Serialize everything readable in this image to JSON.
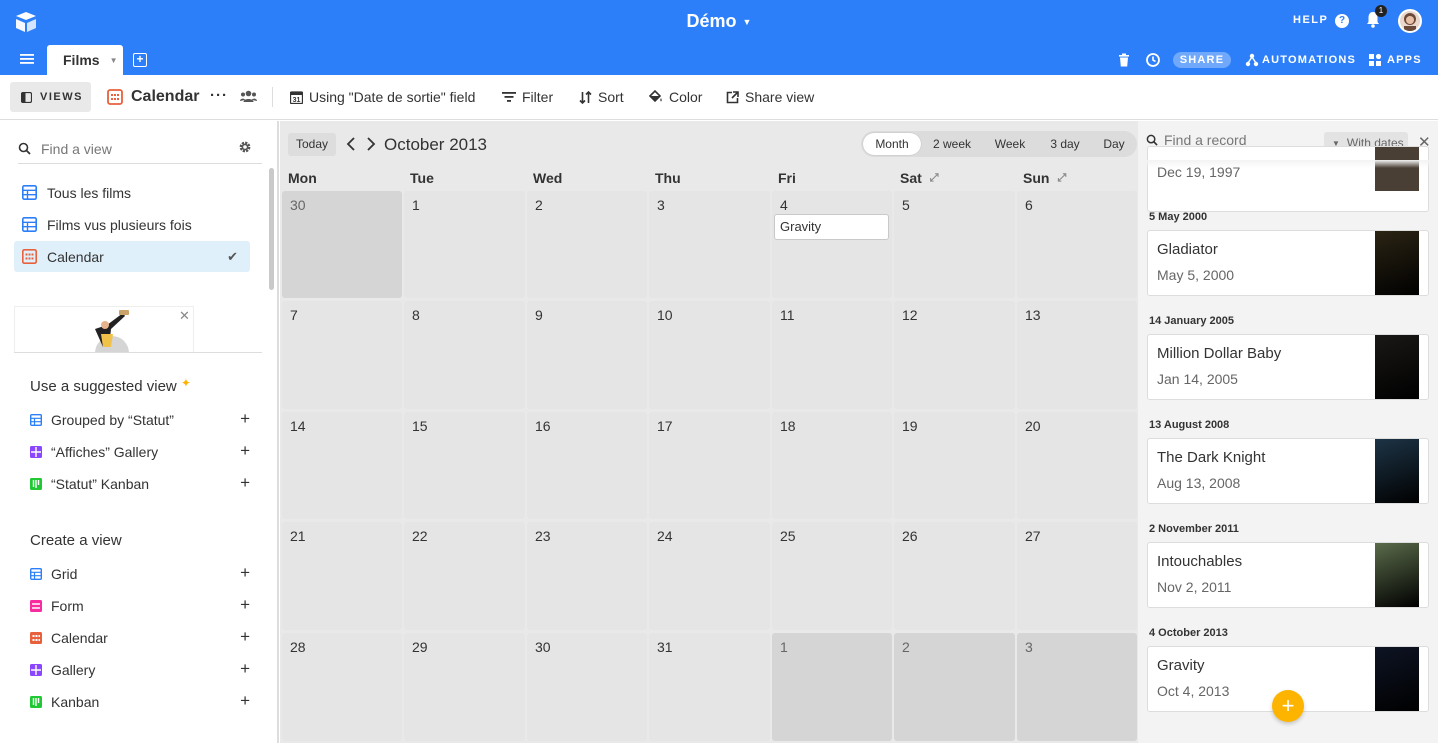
{
  "app": {
    "base_title": "Démo",
    "help_label": "HELP",
    "notification_count": "1",
    "share_label": "SHARE",
    "automations_label": "AUTOMATIONS",
    "apps_label": "APPS",
    "brand_color": "#2d7ff9"
  },
  "table_tab": {
    "label": "Films"
  },
  "toolbar": {
    "views_label": "VIEWS",
    "view_name": "Calendar",
    "more_label": "···",
    "date_field_label": "Using \"Date de sortie\" field",
    "filter_label": "Filter",
    "sort_label": "Sort",
    "color_label": "Color",
    "share_view_label": "Share view"
  },
  "sidebar": {
    "search_placeholder": "Find a view",
    "views": [
      {
        "label": "Tous les films",
        "icon": "grid-view-icon"
      },
      {
        "label": "Films vus plusieurs fois",
        "icon": "grid-view-icon"
      },
      {
        "label": "Calendar",
        "icon": "calendar-view-icon",
        "active": true
      }
    ],
    "suggested_heading": "Use a suggested view",
    "suggested": [
      {
        "label": "Grouped by “Statut”",
        "icon": "grid-view-icon"
      },
      {
        "label": "“Affiches” Gallery",
        "icon": "gallery-view-icon"
      },
      {
        "label": "“Statut” Kanban",
        "icon": "kanban-view-icon"
      }
    ],
    "create_heading": "Create a view",
    "create": [
      {
        "label": "Grid",
        "icon": "grid-view-icon"
      },
      {
        "label": "Form",
        "icon": "form-view-icon"
      },
      {
        "label": "Calendar",
        "icon": "calendar-view-icon"
      },
      {
        "label": "Gallery",
        "icon": "gallery-view-icon"
      },
      {
        "label": "Kanban",
        "icon": "kanban-view-icon"
      }
    ]
  },
  "calendar": {
    "today_label": "Today",
    "month_label": "October 2013",
    "ranges": [
      "Month",
      "2 week",
      "Week",
      "3 day",
      "Day"
    ],
    "active_range": "Month",
    "weekdays": [
      "Mon",
      "Tue",
      "Wed",
      "Thu",
      "Fri",
      "Sat",
      "Sun"
    ],
    "weeks": [
      [
        "30",
        "1",
        "2",
        "3",
        "4",
        "5",
        "6"
      ],
      [
        "7",
        "8",
        "9",
        "10",
        "11",
        "12",
        "13"
      ],
      [
        "14",
        "15",
        "16",
        "17",
        "18",
        "19",
        "20"
      ],
      [
        "21",
        "22",
        "23",
        "24",
        "25",
        "26",
        "27"
      ],
      [
        "28",
        "29",
        "30",
        "31",
        "1",
        "2",
        "3"
      ]
    ],
    "event": {
      "title": "Gravity"
    }
  },
  "records": {
    "search_placeholder": "Find a record",
    "filter_label": "With dates",
    "partial_sub": "Dec 19, 1997",
    "items": [
      {
        "group": "5 May 2000",
        "title": "Gladiator",
        "date": "May 5, 2000",
        "poster": "#2b2414"
      },
      {
        "group": "14 January 2005",
        "title": "Million Dollar Baby",
        "date": "Jan 14, 2005",
        "poster": "#1a1816"
      },
      {
        "group": "13 August 2008",
        "title": "The Dark Knight",
        "date": "Aug 13, 2008",
        "poster": "#1d3446"
      },
      {
        "group": "2 November 2011",
        "title": "Intouchables",
        "date": "Nov 2, 2011",
        "poster": "#5a6b4a"
      },
      {
        "group": "4 October 2013",
        "title": "Gravity",
        "date": "Oct 4, 2013",
        "poster": "#0e1424"
      }
    ]
  }
}
